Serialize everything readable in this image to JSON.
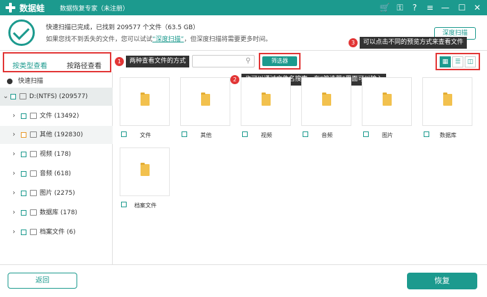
{
  "app": {
    "name": "数据蛙",
    "subtitle": "数据恢复专家（未注册）"
  },
  "header": {
    "status_line": "快速扫描已完成，已找到 209577 个文件（63.5 GB）",
    "hint_prefix": "如果您找不到丢失的文件，您可以试试",
    "deep_scan_link": "“深度扫描”",
    "hint_suffix": "，但深度扫描将需要更多时间。",
    "deep_scan_button": "深度扫描"
  },
  "tabs": [
    {
      "label": "按类型查看"
    },
    {
      "label": "按路径查看"
    }
  ],
  "annotations": {
    "a1": {
      "num": "1",
      "text": "两种查看文件的方式"
    },
    "a2": {
      "num": "2",
      "text": "也可以通过文件名搜索，在“筛选器”里面可以输入"
    },
    "a3": {
      "num": "3",
      "text": "可以点击不同的预览方式来查看文件"
    }
  },
  "search": {
    "placeholder": ""
  },
  "filter_button": "筛选器",
  "sidebar": {
    "quick_scan": "快速扫描",
    "drive": "D:(NTFS) (209577)",
    "items": [
      {
        "label": "文件 (13492)",
        "icon": "file-icon"
      },
      {
        "label": "其他 (192830)",
        "icon": "folder-icon"
      },
      {
        "label": "视频 (178)",
        "icon": "video-icon"
      },
      {
        "label": "音频 (618)",
        "icon": "audio-icon"
      },
      {
        "label": "图片 (2275)",
        "icon": "image-icon"
      },
      {
        "label": "数据库 (178)",
        "icon": "database-icon"
      },
      {
        "label": "档案文件 (6)",
        "icon": "archive-icon"
      }
    ]
  },
  "grid": [
    {
      "label": "文件"
    },
    {
      "label": "其他"
    },
    {
      "label": "视频"
    },
    {
      "label": "音频"
    },
    {
      "label": "图片"
    },
    {
      "label": "数据库"
    },
    {
      "label": "档案文件"
    }
  ],
  "footer": {
    "back": "返回",
    "restore": "恢复"
  },
  "colors": {
    "accent": "#1c9a8e",
    "highlight": "#e23535",
    "folder": "#f2c14e"
  }
}
